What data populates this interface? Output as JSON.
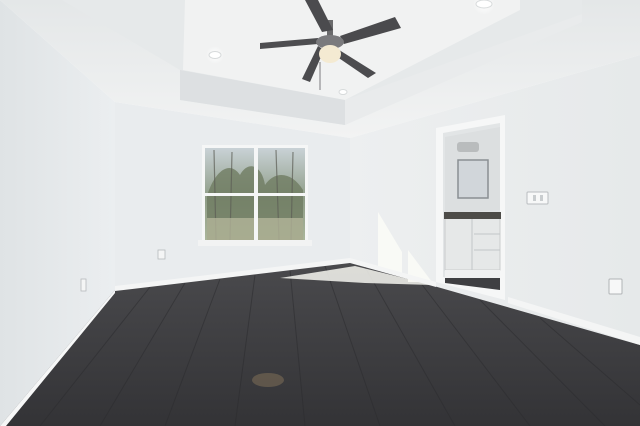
{
  "scene": {
    "kind": "empty-bedroom-interior",
    "palette": {
      "wall": "#e8ebec",
      "wall_shade": "#d3d7d9",
      "ceiling": "#eef0f0",
      "floor": "#3a3a3d",
      "floor_plank": "#2e2e31",
      "trim": "#f6f7f7",
      "fan_blade": "#4a4a4d",
      "window_view": "#8fa07e",
      "sunlight": "#fbfbf7",
      "vanity": "#e4e6e6"
    },
    "elements": [
      "tray-ceiling",
      "ceiling-fan",
      "recessed-lights",
      "double-window",
      "doorway-to-bathroom",
      "vanity",
      "wall-outlets",
      "light-switch",
      "baseboards",
      "dark-plank-floor"
    ]
  }
}
